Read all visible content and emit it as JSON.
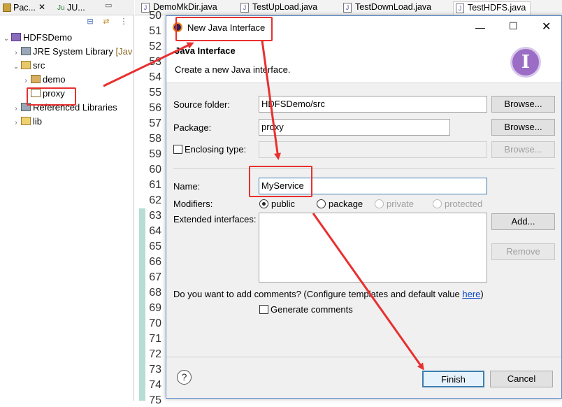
{
  "left_panel": {
    "tabs": [
      "Pac...",
      "JU..."
    ],
    "tree": [
      {
        "label": "HDFSDemo",
        "icon": "project-icon",
        "expanded": true
      },
      {
        "label": "JRE System Library",
        "suffix": "[Jav",
        "icon": "library-icon",
        "expanded": false
      },
      {
        "label": "src",
        "icon": "source-folder-icon",
        "expanded": true
      },
      {
        "label": "demo",
        "icon": "package-icon",
        "expanded": false
      },
      {
        "label": "proxy",
        "icon": "package-icon",
        "expanded": false
      },
      {
        "label": "Referenced Libraries",
        "icon": "library-icon",
        "expanded": false
      },
      {
        "label": "lib",
        "icon": "folder-icon",
        "expanded": false
      }
    ]
  },
  "editor": {
    "tabs": [
      "DemoMkDir.java",
      "TestUpLoad.java",
      "TestDownLoad.java",
      "TestHDFS.java"
    ],
    "line_numbers": [
      "50",
      "51",
      "52",
      "53",
      "54",
      "55",
      "56",
      "57",
      "58",
      "59",
      "60",
      "61",
      "62",
      "63",
      "64",
      "65",
      "66",
      "67",
      "68",
      "69",
      "70",
      "71",
      "72",
      "73",
      "74",
      "75"
    ]
  },
  "dialog": {
    "title": "New Java Interface",
    "heading": "Java Interface",
    "description": "Create a new Java interface.",
    "source_folder": {
      "label": "Source folder:",
      "value": "HDFSDemo/src",
      "button": "Browse..."
    },
    "package": {
      "label": "Package:",
      "value": "proxy",
      "button": "Browse..."
    },
    "enclosing": {
      "label": "Enclosing type:",
      "value": "",
      "button": "Browse...",
      "checked": false
    },
    "name": {
      "label": "Name:",
      "value": "MyService"
    },
    "modifiers": {
      "label": "Modifiers:",
      "options": [
        "public",
        "package",
        "private",
        "protected"
      ],
      "selected": "public"
    },
    "extended": {
      "label": "Extended interfaces:",
      "add": "Add...",
      "remove": "Remove"
    },
    "comments": {
      "question": "Do you want to add comments? (Configure templates and default value ",
      "link": "here",
      "close": ")",
      "checkbox": "Generate comments",
      "checked": false
    },
    "buttons": {
      "finish": "Finish",
      "cancel": "Cancel"
    },
    "help": "?"
  },
  "colors": {
    "annotation": "#e83030",
    "accent": "#3c7fb1"
  }
}
